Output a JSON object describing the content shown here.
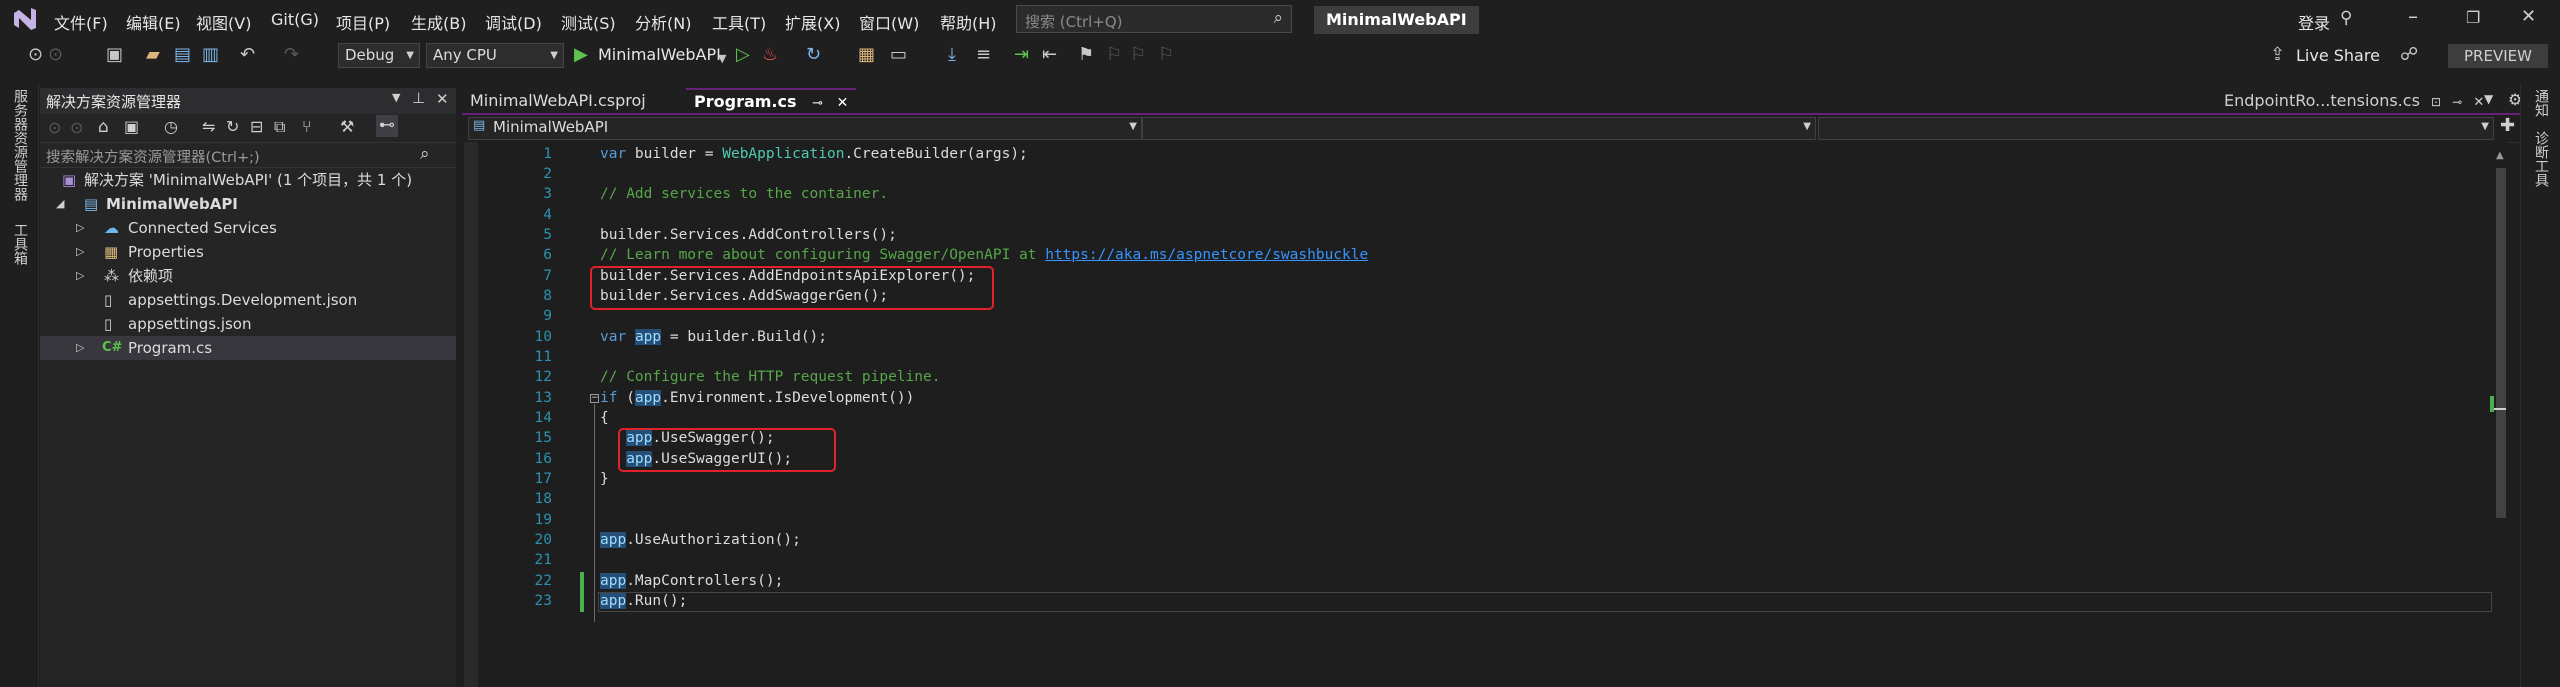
{
  "menu": {
    "items": [
      "文件(F)",
      "编辑(E)",
      "视图(V)",
      "Git(G)",
      "项目(P)",
      "生成(B)",
      "调试(D)",
      "测试(S)",
      "分析(N)",
      "工具(T)",
      "扩展(X)",
      "窗口(W)",
      "帮助(H)"
    ],
    "search_placeholder": "搜索 (Ctrl+Q)",
    "solution_name": "MinimalWebAPI",
    "sign_in": "登录",
    "live_share": "Live Share",
    "preview": "PREVIEW"
  },
  "toolbar": {
    "config": "Debug",
    "platform": "Any CPU",
    "run_target": "MinimalWebAPI"
  },
  "left_strip": {
    "server_explorer": "服务器资源管理器",
    "toolbox": "工具箱"
  },
  "solution_explorer": {
    "title": "解决方案资源管理器",
    "search_placeholder": "搜索解决方案资源管理器(Ctrl+;)",
    "solution_line": "解决方案 'MinimalWebAPI' (1 个项目，共 1 个)",
    "project": "MinimalWebAPI",
    "items": {
      "connected_services": "Connected Services",
      "properties": "Properties",
      "dependencies": "依赖项",
      "appsettings_dev": "appsettings.Development.json",
      "appsettings": "appsettings.json",
      "program": "Program.cs"
    }
  },
  "tabs": {
    "csproj": "MinimalWebAPI.csproj",
    "program": "Program.cs",
    "right_tab": "EndpointRo...tensions.cs"
  },
  "navbar": {
    "project": "MinimalWebAPI"
  },
  "right_strip": {
    "notifications": "通知",
    "diagnostic_tools": "诊断工具"
  },
  "code": {
    "comment_add_services": "// Add services to the container.",
    "comment_learn_more": "// Learn more about configuring Swagger/OpenAPI at ",
    "swagger_url": "https://aka.ms/aspnetcore/swashbuckle",
    "comment_configure": "// Configure the HTTP request pipeline."
  },
  "colors": {
    "accent_purple": "#68217a",
    "keyword": "#569cd6",
    "type": "#4ec9b0",
    "comment": "#57a64a",
    "highlight_box": "#e0222a",
    "change_bar": "#4caf50"
  }
}
